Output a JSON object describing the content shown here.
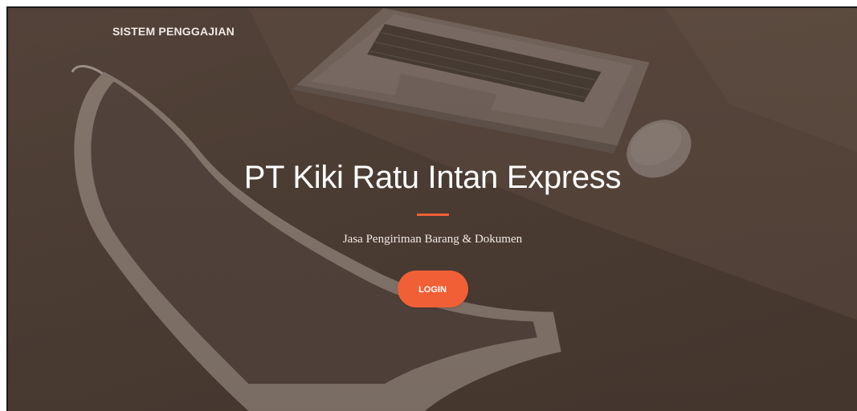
{
  "navbar": {
    "brand": "SISTEM PENGGAJIAN"
  },
  "hero": {
    "title": "PT Kiki Ratu Intan Express",
    "subtitle": "Jasa Pengiriman Barang & Dokumen",
    "login_label": "LOGIN"
  },
  "background": {
    "depicts": [
      "laptop",
      "mouse",
      "chair"
    ]
  },
  "colors": {
    "accent": "#f05f35",
    "overlay": "#4f4139",
    "text": "#ffffff"
  }
}
